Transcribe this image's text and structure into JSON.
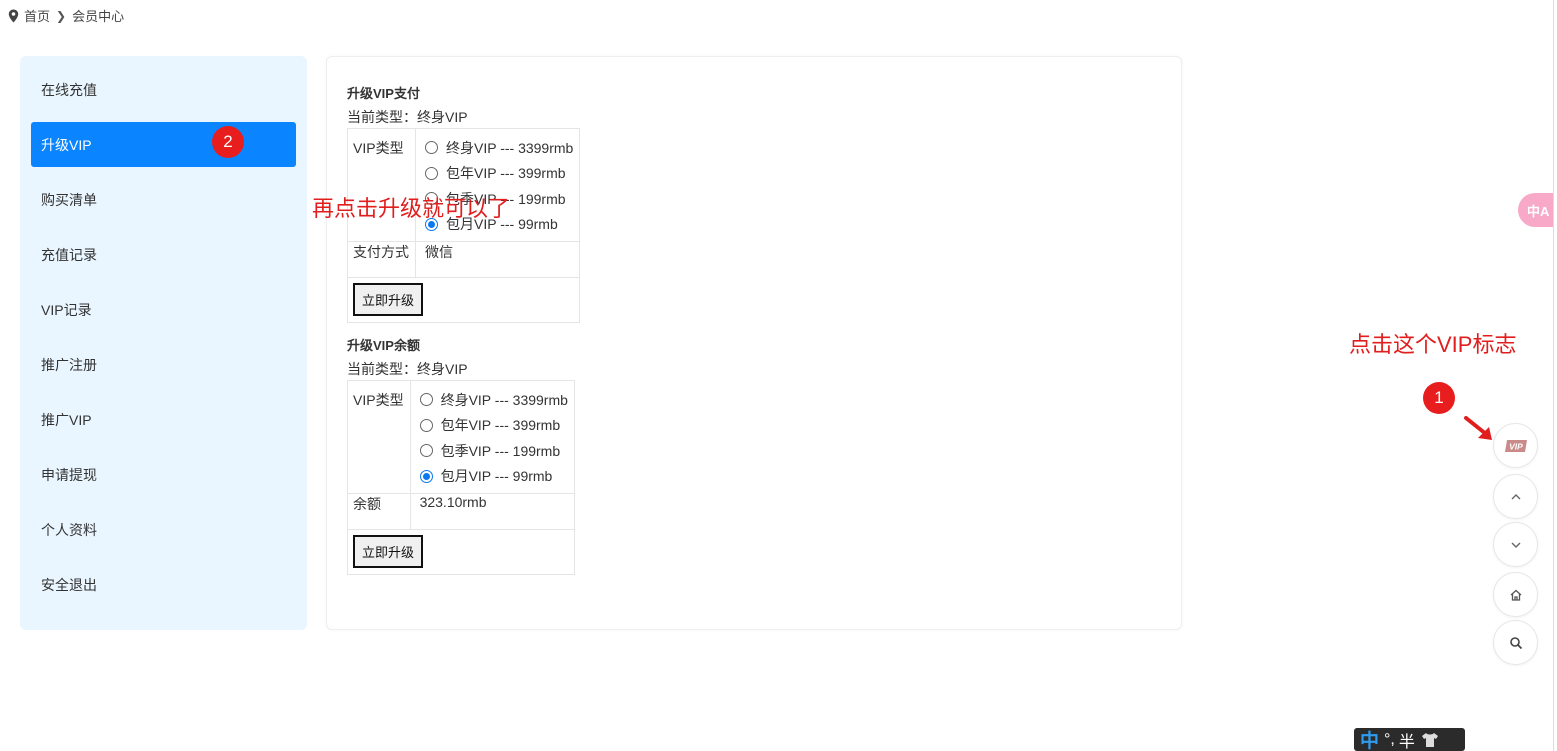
{
  "breadcrumb": {
    "home": "首页",
    "current": "会员中心"
  },
  "sidebar": {
    "items": [
      {
        "label": "在线充值"
      },
      {
        "label": "升级VIP"
      },
      {
        "label": "购买清单"
      },
      {
        "label": "充值记录"
      },
      {
        "label": "VIP记录"
      },
      {
        "label": "推广注册"
      },
      {
        "label": "推广VIP"
      },
      {
        "label": "申请提现"
      },
      {
        "label": "个人资料"
      },
      {
        "label": "安全退出"
      }
    ]
  },
  "pay_section": {
    "title": "升级VIP支付",
    "current_type": "当前类型：终身VIP",
    "vip_type_label": "VIP类型",
    "options": [
      "终身VIP --- 3399rmb",
      "包年VIP --- 399rmb",
      "包季VIP --- 199rmb",
      "包月VIP --- 99rmb"
    ],
    "selected_option": "包月VIP --- 99rmb",
    "pay_method_label": "支付方式",
    "pay_method_value": "微信",
    "submit": "立即升级"
  },
  "balance_section": {
    "title": "升级VIP余额",
    "current_type": "当前类型：终身VIP",
    "vip_type_label": "VIP类型",
    "options": [
      "终身VIP --- 3399rmb",
      "包年VIP --- 399rmb",
      "包季VIP --- 199rmb",
      "包月VIP --- 99rmb"
    ],
    "selected_option": "包月VIP --- 99rmb",
    "balance_label": "余额",
    "balance_value": "323.10rmb",
    "submit": "立即升级"
  },
  "annotations": {
    "step2_badge": "2",
    "step2_text": "再点击升级就可以了",
    "step1_badge": "1",
    "step1_text": "点击这个VIP标志"
  },
  "floating_toolbar": {
    "vip_icon_text": "VIP",
    "icons": [
      "vip-icon",
      "chevron-up-icon",
      "chevron-down-icon",
      "home-icon",
      "search-icon"
    ]
  },
  "translate_tab": {
    "label": "中A"
  },
  "ime_bar": {
    "mode": "中",
    "punct": "°,",
    "width": "半"
  },
  "colors": {
    "accent": "#0a84ff",
    "sidebar_bg": "#e9f6ff",
    "annotation": "#e11d1d"
  }
}
